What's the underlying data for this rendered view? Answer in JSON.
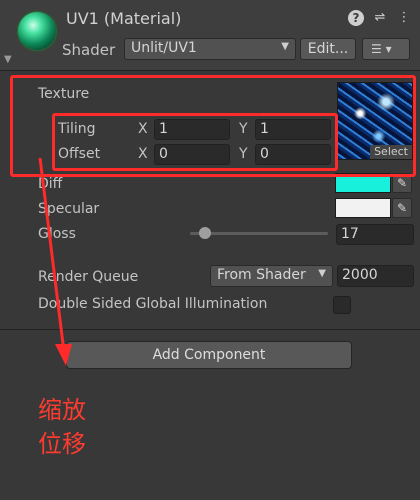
{
  "header": {
    "title": "UV1 (Material)",
    "shader_label": "Shader",
    "shader_value": "Unlit/UV1",
    "edit_label": "Edit...",
    "icons": [
      "help-icon",
      "settings-sliders-icon",
      "more-icon"
    ]
  },
  "properties": {
    "texture_label": "Texture",
    "select_label": "Select",
    "tiling_label": "Tiling",
    "tiling_x": "1",
    "tiling_y": "1",
    "offset_label": "Offset",
    "offset_x": "0",
    "offset_y": "0",
    "axis_x": "X",
    "axis_y": "Y",
    "diff_label": "Diff",
    "diff_color": "#19f0dc",
    "specular_label": "Specular",
    "specular_color": "#f2f2f2",
    "gloss_label": "Gloss",
    "gloss_value": "17",
    "render_queue_label": "Render Queue",
    "render_queue_mode": "From Shader",
    "render_queue_value": "2000",
    "double_sided_label": "Double Sided Global Illumination",
    "double_sided_checked": false
  },
  "footer": {
    "add_component_label": "Add Component"
  },
  "annotation": {
    "line1": "缩放",
    "line2": "位移",
    "color": "#ff2a2a"
  }
}
